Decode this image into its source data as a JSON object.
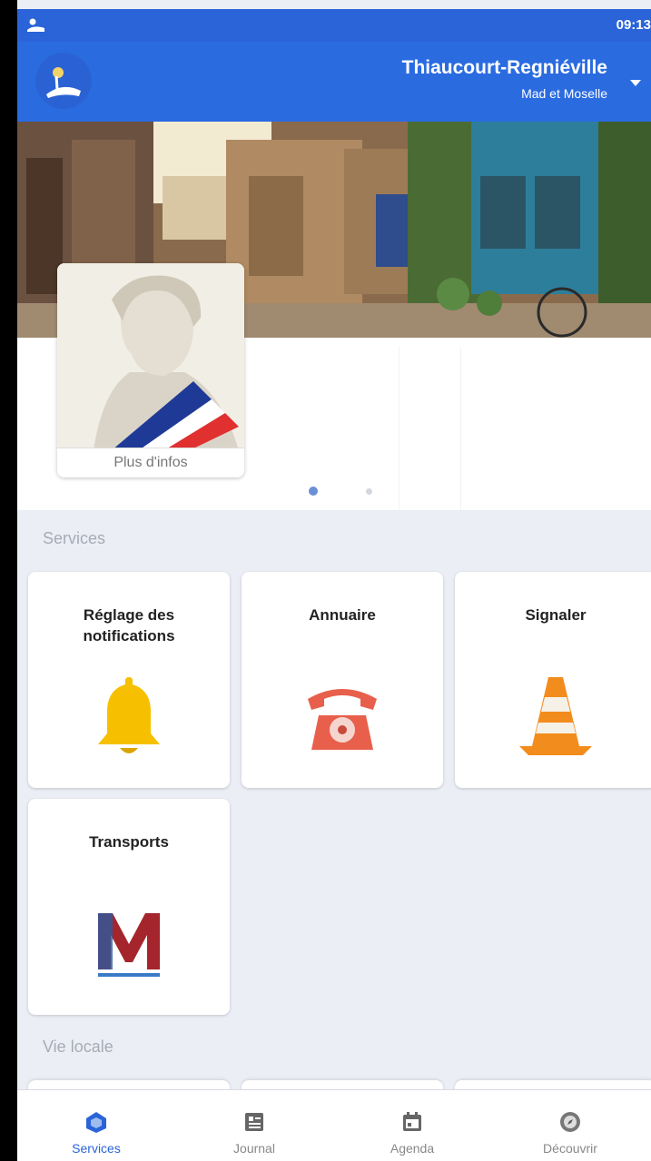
{
  "status_bar": {
    "time": "09:13"
  },
  "header": {
    "city": "Thiaucourt-Regniéville",
    "region": "Mad et Moselle"
  },
  "carousel": {
    "more_info": "Plus d'infos",
    "pages": 2,
    "active_page": 1
  },
  "sections": {
    "services": "Services",
    "local_life": "Vie locale"
  },
  "services": [
    {
      "label": "Réglage des notifications",
      "icon": "bell-icon"
    },
    {
      "label": "Annuaire",
      "icon": "telephone-icon"
    },
    {
      "label": "Signaler",
      "icon": "traffic-cone-icon"
    },
    {
      "label": "Transports",
      "icon": "transport-logo-icon"
    }
  ],
  "bottom_nav": [
    {
      "label": "Services",
      "icon": "services-icon",
      "active": true
    },
    {
      "label": "Journal",
      "icon": "newspaper-icon",
      "active": false
    },
    {
      "label": "Agenda",
      "icon": "calendar-icon",
      "active": false
    },
    {
      "label": "Découvrir",
      "icon": "compass-icon",
      "active": false
    }
  ],
  "colors": {
    "primary": "#2a6be0",
    "background": "#eceef6",
    "bell": "#f6c000",
    "phone": "#e8604c",
    "cone": "#f28c1c"
  }
}
